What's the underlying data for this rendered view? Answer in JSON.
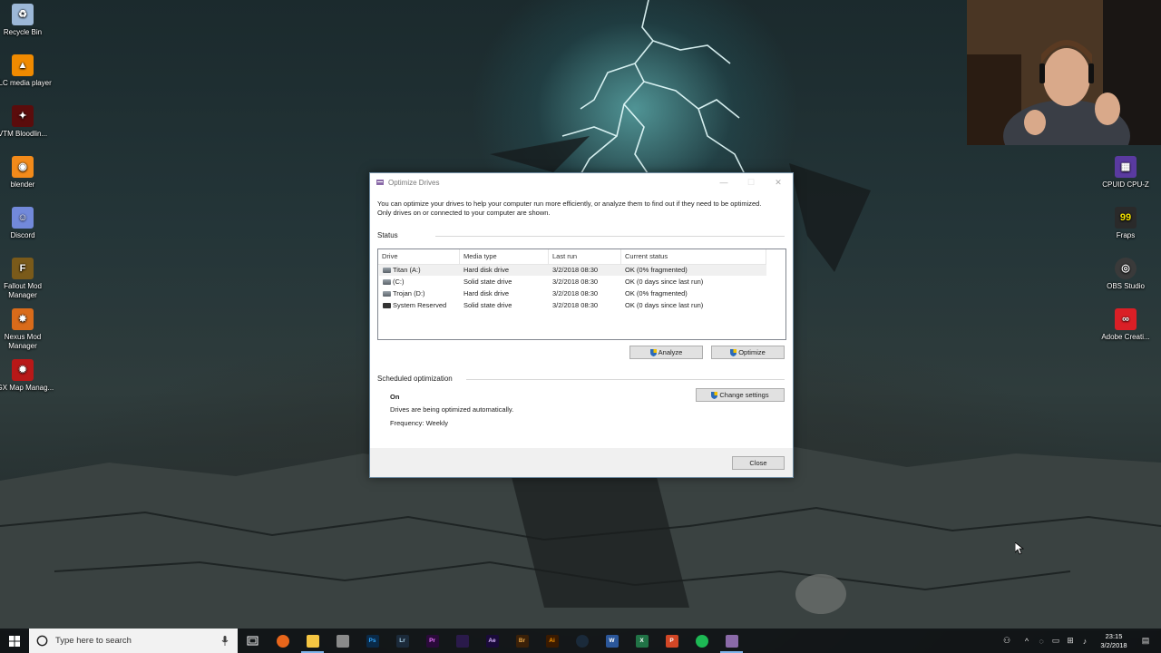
{
  "desktop": {
    "icons_left": [
      {
        "label": "Recycle Bin",
        "icon": "recycle-bin-icon",
        "color": "#9cb8d8"
      },
      {
        "label": "VLC media player",
        "icon": "vlc-icon",
        "color": "#f08a00"
      },
      {
        "label": "VTM Bloodlin...",
        "icon": "vtm-icon",
        "color": "#5a0c0c"
      },
      {
        "label": "blender",
        "icon": "blender-icon",
        "color": "#f28a1a"
      },
      {
        "label": "Discord",
        "icon": "discord-icon",
        "color": "#7289da"
      },
      {
        "label": "Fallout Mod Manager",
        "icon": "fallout-mod-manager-icon",
        "color": "#7a5a1a"
      },
      {
        "label": "Nexus Mod Manager",
        "icon": "nexus-mod-manager-icon",
        "color": "#d96b1a"
      },
      {
        "label": "UGX Map Manag...",
        "icon": "ugx-map-manager-icon",
        "color": "#b81818"
      }
    ],
    "icons_right": [
      {
        "label": "CPUID CPU-Z",
        "icon": "cpuz-icon",
        "color": "#5a3aa0"
      },
      {
        "label": "Fraps",
        "icon": "fraps-icon",
        "color": "#2a2a2a"
      },
      {
        "label": "OBS Studio",
        "icon": "obs-icon",
        "color": "#3a3a3a"
      },
      {
        "label": "Adobe Creati...",
        "icon": "adobe-creative-cloud-icon",
        "color": "#da1f26"
      }
    ]
  },
  "dialog": {
    "title": "Optimize Drives",
    "description": "You can optimize your drives to help your computer run more efficiently, or analyze them to find out if they need to be optimized. Only drives on or connected to your computer are shown.",
    "status_label": "Status",
    "columns": [
      "Drive",
      "Media type",
      "Last run",
      "Current status"
    ],
    "drives": [
      {
        "drive": "Titan (A:)",
        "media": "Hard disk drive",
        "last_run": "3/2/2018 08:30",
        "status": "OK (0% fragmented)"
      },
      {
        "drive": "(C:)",
        "media": "Solid state drive",
        "last_run": "3/2/2018 08:30",
        "status": "OK (0 days since last run)"
      },
      {
        "drive": "Trojan (D:)",
        "media": "Hard disk drive",
        "last_run": "3/2/2018 08:30",
        "status": "OK (0% fragmented)"
      },
      {
        "drive": "System Reserved",
        "media": "Solid state drive",
        "last_run": "3/2/2018 08:30",
        "status": "OK (0 days since last run)"
      }
    ],
    "analyze_label": "Analyze",
    "optimize_label": "Optimize",
    "scheduled_label": "Scheduled optimization",
    "scheduled_state": "On",
    "scheduled_desc": "Drives are being optimized automatically.",
    "frequency": "Frequency: Weekly",
    "change_settings_label": "Change settings",
    "close_label": "Close"
  },
  "taskbar": {
    "search_placeholder": "Type here to search",
    "apps": [
      {
        "name": "task-view",
        "text": "",
        "color": "#000000"
      },
      {
        "name": "firefox",
        "text": "",
        "color": "#e8661b"
      },
      {
        "name": "file-explorer",
        "text": "",
        "color": "#f4c542"
      },
      {
        "name": "installer",
        "text": "",
        "color": "#8a8a8a"
      },
      {
        "name": "photoshop",
        "text": "Ps",
        "color": "#0a2a48"
      },
      {
        "name": "lightroom",
        "text": "Lr",
        "color": "#1b2a3a"
      },
      {
        "name": "premiere",
        "text": "Pr",
        "color": "#2a0a3a"
      },
      {
        "name": "media-encoder",
        "text": "",
        "color": "#2a1a4a"
      },
      {
        "name": "after-effects",
        "text": "Ae",
        "color": "#1a0a3a"
      },
      {
        "name": "bridge",
        "text": "Br",
        "color": "#3a2008"
      },
      {
        "name": "illustrator",
        "text": "Ai",
        "color": "#3a1a00"
      },
      {
        "name": "steam",
        "text": "",
        "color": "#1a2a3a"
      },
      {
        "name": "word",
        "text": "W",
        "color": "#2b579a"
      },
      {
        "name": "excel",
        "text": "X",
        "color": "#217346"
      },
      {
        "name": "powerpoint",
        "text": "P",
        "color": "#d24726"
      },
      {
        "name": "spotify",
        "text": "",
        "color": "#1db954"
      },
      {
        "name": "optimize-drives",
        "text": "",
        "color": "#8a6aa8"
      }
    ],
    "time": "23:15",
    "date": "3/2/2018"
  }
}
